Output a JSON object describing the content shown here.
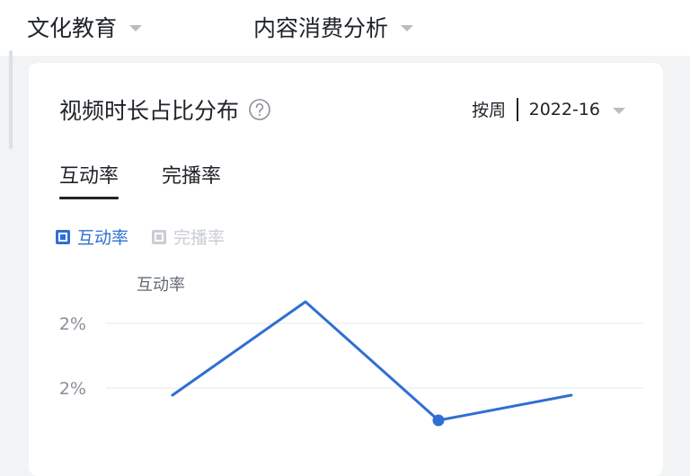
{
  "filters": {
    "category": "文化教育",
    "analysis": "内容消费分析"
  },
  "card": {
    "title": "视频时长占比分布",
    "help_icon": "question-circle-icon",
    "period_label": "按周",
    "period_value": "2022-16"
  },
  "tabs": [
    {
      "label": "互动率",
      "active": true
    },
    {
      "label": "完播率",
      "active": false
    }
  ],
  "legend": [
    {
      "label": "互动率",
      "color": "#2f6fd1",
      "active": true
    },
    {
      "label": "完播率",
      "color": "#c9cdd4",
      "active": false
    }
  ],
  "chart_data": {
    "type": "line",
    "ylabel": "互动率",
    "ytick_labels": [
      "2%",
      "2%"
    ],
    "series": [
      {
        "name": "互动率",
        "color": "#2f6fd1",
        "values": [
          0.02,
          0.0252,
          0.0186,
          0.02
        ],
        "highlight_index": 2
      }
    ],
    "ylim": [
      0.017,
      0.026
    ],
    "ytick_values": [
      0.024,
      0.0204
    ]
  }
}
